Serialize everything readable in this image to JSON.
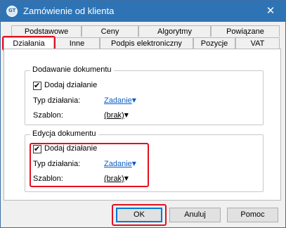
{
  "window": {
    "title": "Zamówienie od klienta",
    "close_glyph": "✕",
    "icon": "app-logo-icon"
  },
  "tabs_row1": [
    {
      "label": "Podstawowe"
    },
    {
      "label": "Ceny"
    },
    {
      "label": "Algorytmy"
    },
    {
      "label": "Powiązane"
    }
  ],
  "tabs_row2": [
    {
      "label": "Działania",
      "active": true
    },
    {
      "label": "Inne"
    },
    {
      "label": "Podpis elektroniczny"
    },
    {
      "label": "Pozycje"
    },
    {
      "label": "VAT"
    }
  ],
  "group_add": {
    "title": "Dodawanie dokumentu",
    "checkbox_label": "Dodaj działanie",
    "checked": true,
    "type_label": "Typ działania:",
    "type_value": "Zadanie",
    "template_label": "Szablon:",
    "template_value": "(brak)"
  },
  "group_edit": {
    "title": "Edycja dokumentu",
    "checkbox_label": "Dodaj działanie",
    "checked": true,
    "type_label": "Typ działania:",
    "type_value": "Zadanie",
    "template_label": "Szablon:",
    "template_value": "(brak)"
  },
  "buttons": {
    "ok": "OK",
    "cancel": "Anuluj",
    "help": "Pomoc"
  },
  "glyphs": {
    "check": "✔",
    "dropdown": "▼"
  },
  "colors": {
    "titlebar": "#2e74b5",
    "highlight": "#e3101f",
    "link": "#0a5fc4"
  }
}
